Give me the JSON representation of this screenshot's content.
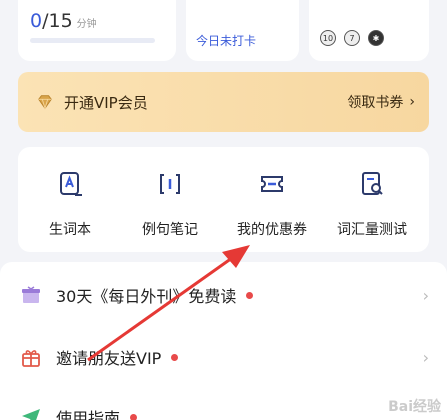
{
  "stats": {
    "minutes_done": "0",
    "minutes_total": "/15",
    "minutes_unit": "分钟",
    "minutes_progress": 0.0,
    "checkin_text": "今日未打卡",
    "medals": [
      "10",
      "7",
      "✱"
    ]
  },
  "vip": {
    "label": "开通VIP会员",
    "action": "领取书券",
    "chevron": "›",
    "accent": "#f7d7a0"
  },
  "tools": [
    {
      "label": "生词本",
      "icon": "vocab-book-icon"
    },
    {
      "label": "例句笔记",
      "icon": "notes-icon"
    },
    {
      "label": "我的优惠券",
      "icon": "coupon-icon"
    },
    {
      "label": "词汇量测试",
      "icon": "vocab-test-icon"
    }
  ],
  "list": [
    {
      "label": "30天《每日外刊》免费读",
      "icon": "gift-box-icon",
      "badge_dot": true
    },
    {
      "label": "邀请朋友送VIP",
      "icon": "gift-icon",
      "badge_dot": true
    },
    {
      "label": "使用指南",
      "icon": "paper-plane-icon",
      "badge_dot": true
    }
  ],
  "colors": {
    "primary": "#3a5bd9",
    "dot": "#e84a4a",
    "annotation_arrow": "#e53935"
  },
  "watermark": "Bai经验"
}
